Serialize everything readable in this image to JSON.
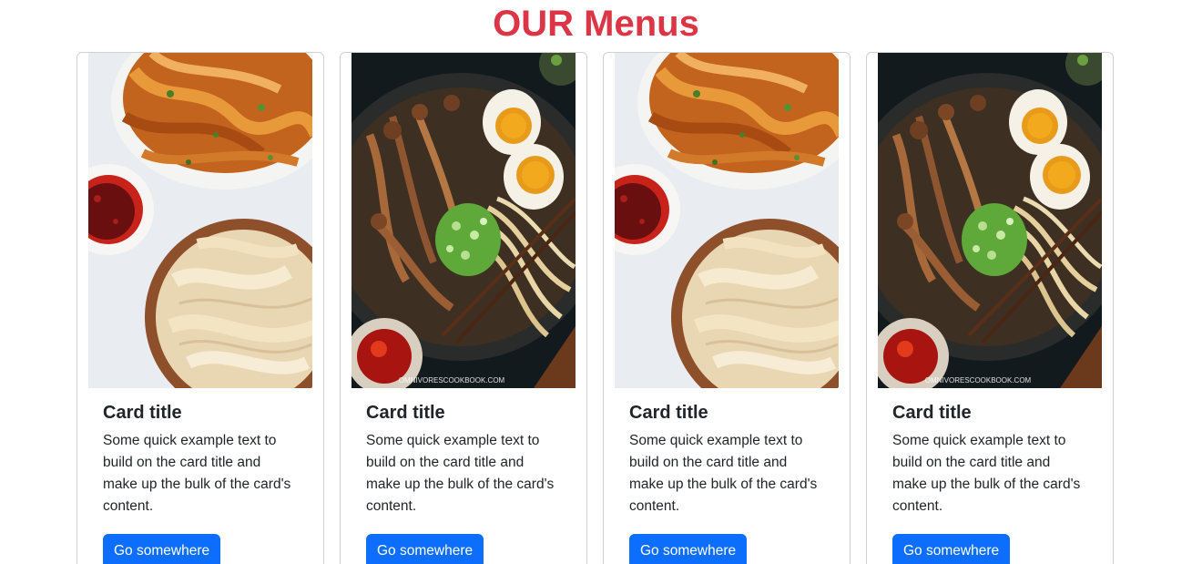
{
  "page": {
    "title": "OUR Menus"
  },
  "colors": {
    "title": "#dc3545",
    "button": "#0d6efd"
  },
  "cards": [
    {
      "image": "biang-biang-noodles-photo",
      "title": "Card title",
      "text": "Some quick example text to build on the card title and make up the bulk of the card's content.",
      "button_label": "Go somewhere"
    },
    {
      "image": "mushroom-ramen-photo",
      "title": "Card title",
      "text": "Some quick example text to build on the card title and make up the bulk of the card's content.",
      "button_label": "Go somewhere",
      "watermark": "OMNIVORESCOOKBOOK.COM"
    },
    {
      "image": "biang-biang-noodles-photo",
      "title": "Card title",
      "text": "Some quick example text to build on the card title and make up the bulk of the card's content.",
      "button_label": "Go somewhere"
    },
    {
      "image": "mushroom-ramen-photo",
      "title": "Card title",
      "text": "Some quick example text to build on the card title and make up the bulk of the card's content.",
      "button_label": "Go somewhere",
      "watermark": "OMNIVORESCOOKBOOK.COM"
    }
  ]
}
